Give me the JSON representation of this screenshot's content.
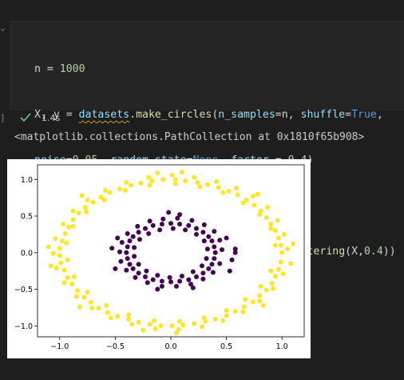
{
  "cell": {
    "code_lines": [
      "n = 1000",
      "X, y = datasets.make_circles(n_samples=n, shuffle=True,",
      "noise=0.05, random_state=None, factor = 0.4)",
      "",
      "plt.scatter(X[:,0],X[:,1],c = spectral_clustering(X,0.4))"
    ],
    "exec_time": "1.4s",
    "output_text": "<matplotlib.collections.PathCollection at 0x1810f65b908>"
  },
  "colors": {
    "outer": "#fde725",
    "inner": "#440154",
    "check": "#73c991"
  },
  "chart_data": {
    "type": "scatter",
    "title": "",
    "xlabel": "",
    "ylabel": "",
    "xlim": [
      -1.2,
      1.2
    ],
    "ylim": [
      -1.15,
      1.2
    ],
    "xticks": [
      -1.0,
      -0.5,
      0.0,
      0.5,
      1.0
    ],
    "xtick_labels": [
      "−1.0",
      "−0.5",
      "0.0",
      "0.5",
      "1.0"
    ],
    "yticks": [
      -1.0,
      -0.5,
      0.0,
      0.5,
      1.0
    ],
    "ytick_labels": [
      "−1.0",
      "−0.5",
      "0.0",
      "0.5",
      "1.0"
    ],
    "grid": false,
    "series": [
      {
        "color": "#fde725",
        "points": [
          [
            1.0,
            0.0
          ],
          [
            0.99,
            0.1
          ],
          [
            0.97,
            0.2
          ],
          [
            0.94,
            0.3
          ],
          [
            0.9,
            0.39
          ],
          [
            0.86,
            0.48
          ],
          [
            0.81,
            0.57
          ],
          [
            0.75,
            0.65
          ],
          [
            0.68,
            0.72
          ],
          [
            0.6,
            0.79
          ],
          [
            0.52,
            0.84
          ],
          [
            0.43,
            0.89
          ],
          [
            0.33,
            0.93
          ],
          [
            0.24,
            0.96
          ],
          [
            0.13,
            0.98
          ],
          [
            0.04,
            1.0
          ],
          [
            -0.07,
            1.0
          ],
          [
            -0.17,
            0.98
          ],
          [
            -0.27,
            0.95
          ],
          [
            -0.36,
            0.92
          ],
          [
            -0.46,
            0.87
          ],
          [
            -0.55,
            0.82
          ],
          [
            -0.63,
            0.76
          ],
          [
            -0.7,
            0.69
          ],
          [
            -0.77,
            0.62
          ],
          [
            -0.83,
            0.54
          ],
          [
            -0.88,
            0.45
          ],
          [
            -0.92,
            0.35
          ],
          [
            -0.95,
            0.26
          ],
          [
            -0.98,
            0.16
          ],
          [
            -1.0,
            0.06
          ],
          [
            -1.0,
            -0.04
          ],
          [
            -0.99,
            -0.14
          ],
          [
            -0.96,
            -0.24
          ],
          [
            -0.93,
            -0.34
          ],
          [
            -0.89,
            -0.43
          ],
          [
            -0.84,
            -0.52
          ],
          [
            -0.78,
            -0.61
          ],
          [
            -0.72,
            -0.68
          ],
          [
            -0.65,
            -0.76
          ],
          [
            -0.57,
            -0.82
          ],
          [
            -0.48,
            -0.87
          ],
          [
            -0.38,
            -0.91
          ],
          [
            -0.29,
            -0.95
          ],
          [
            -0.19,
            -0.98
          ],
          [
            -0.09,
            -1.0
          ],
          [
            0.01,
            -1.0
          ],
          [
            0.11,
            -0.99
          ],
          [
            0.21,
            -0.97
          ],
          [
            0.31,
            -0.94
          ],
          [
            0.4,
            -0.91
          ],
          [
            0.5,
            -0.86
          ],
          [
            0.58,
            -0.8
          ],
          [
            0.66,
            -0.74
          ],
          [
            0.74,
            -0.67
          ],
          [
            0.8,
            -0.59
          ],
          [
            0.86,
            -0.51
          ],
          [
            0.91,
            -0.42
          ],
          [
            0.94,
            -0.32
          ],
          [
            0.97,
            -0.23
          ],
          [
            0.99,
            -0.13
          ],
          [
            1.05,
            0.05
          ],
          [
            1.02,
            0.25
          ],
          [
            0.96,
            0.44
          ],
          [
            0.87,
            0.62
          ],
          [
            0.74,
            0.77
          ],
          [
            0.59,
            0.88
          ],
          [
            0.41,
            0.97
          ],
          [
            0.21,
            1.03
          ],
          [
            0.01,
            1.06
          ],
          [
            -0.2,
            1.03
          ],
          [
            -0.4,
            0.96
          ],
          [
            -0.59,
            0.85
          ],
          [
            -0.75,
            0.72
          ],
          [
            -0.88,
            0.57
          ],
          [
            -0.97,
            0.39
          ],
          [
            -1.04,
            0.19
          ],
          [
            -1.06,
            -0.01
          ],
          [
            -1.03,
            -0.21
          ],
          [
            -0.96,
            -0.41
          ],
          [
            -0.85,
            -0.6
          ],
          [
            -0.71,
            -0.76
          ],
          [
            -0.54,
            -0.89
          ],
          [
            -0.35,
            -0.98
          ],
          [
            -0.14,
            -1.04
          ],
          [
            0.07,
            -1.05
          ],
          [
            0.28,
            -1.01
          ],
          [
            0.47,
            -0.93
          ],
          [
            0.65,
            -0.81
          ],
          [
            0.8,
            -0.66
          ],
          [
            0.92,
            -0.49
          ],
          [
            1.01,
            -0.29
          ],
          [
            0.94,
            0.1
          ],
          [
            0.9,
            0.33
          ],
          [
            0.8,
            0.52
          ],
          [
            0.65,
            0.68
          ],
          [
            0.47,
            0.82
          ],
          [
            0.26,
            0.9
          ],
          [
            0.04,
            0.94
          ],
          [
            -0.19,
            0.92
          ],
          [
            -0.41,
            0.85
          ],
          [
            -0.6,
            0.72
          ],
          [
            -0.76,
            0.56
          ],
          [
            -0.88,
            0.36
          ],
          [
            -0.94,
            0.13
          ],
          [
            -0.93,
            -0.1
          ],
          [
            -0.87,
            -0.33
          ],
          [
            -0.75,
            -0.54
          ],
          [
            -0.58,
            -0.72
          ],
          [
            -0.38,
            -0.85
          ],
          [
            -0.15,
            -0.93
          ],
          [
            0.08,
            -0.94
          ],
          [
            0.3,
            -0.89
          ],
          [
            0.5,
            -0.79
          ],
          [
            0.67,
            -0.64
          ],
          [
            0.81,
            -0.46
          ],
          [
            0.9,
            -0.25
          ],
          [
            1.1,
            0.12
          ],
          [
            1.08,
            -0.15
          ],
          [
            -1.1,
            0.08
          ],
          [
            -1.08,
            -0.18
          ],
          [
            0.1,
            1.1
          ],
          [
            -0.12,
            1.09
          ],
          [
            0.05,
            -1.1
          ],
          [
            -0.25,
            -1.06
          ],
          [
            0.78,
            0.8
          ],
          [
            -0.8,
            0.78
          ],
          [
            -0.82,
            -0.74
          ],
          [
            0.83,
            -0.72
          ]
        ]
      },
      {
        "color": "#440154",
        "points": [
          [
            0.4,
            0.0
          ],
          [
            0.39,
            0.08
          ],
          [
            0.37,
            0.16
          ],
          [
            0.34,
            0.22
          ],
          [
            0.29,
            0.28
          ],
          [
            0.23,
            0.33
          ],
          [
            0.16,
            0.37
          ],
          [
            0.08,
            0.39
          ],
          [
            0.0,
            0.4
          ],
          [
            -0.08,
            0.39
          ],
          [
            -0.16,
            0.37
          ],
          [
            -0.23,
            0.33
          ],
          [
            -0.29,
            0.28
          ],
          [
            -0.34,
            0.22
          ],
          [
            -0.37,
            0.16
          ],
          [
            -0.39,
            0.08
          ],
          [
            -0.4,
            0.0
          ],
          [
            -0.39,
            -0.08
          ],
          [
            -0.37,
            -0.16
          ],
          [
            -0.34,
            -0.22
          ],
          [
            -0.29,
            -0.28
          ],
          [
            -0.23,
            -0.33
          ],
          [
            -0.16,
            -0.37
          ],
          [
            -0.08,
            -0.39
          ],
          [
            0.0,
            -0.4
          ],
          [
            0.08,
            -0.39
          ],
          [
            0.16,
            -0.37
          ],
          [
            0.23,
            -0.33
          ],
          [
            0.29,
            -0.28
          ],
          [
            0.34,
            -0.22
          ],
          [
            0.37,
            -0.16
          ],
          [
            0.39,
            -0.08
          ],
          [
            0.46,
            0.04
          ],
          [
            0.44,
            0.17
          ],
          [
            0.39,
            0.29
          ],
          [
            0.3,
            0.38
          ],
          [
            0.19,
            0.44
          ],
          [
            0.06,
            0.47
          ],
          [
            -0.07,
            0.46
          ],
          [
            -0.19,
            0.43
          ],
          [
            -0.3,
            0.36
          ],
          [
            -0.39,
            0.26
          ],
          [
            -0.44,
            0.14
          ],
          [
            -0.46,
            0.01
          ],
          [
            -0.45,
            -0.12
          ],
          [
            -0.4,
            -0.24
          ],
          [
            -0.32,
            -0.34
          ],
          [
            -0.21,
            -0.41
          ],
          [
            -0.08,
            -0.46
          ],
          [
            0.05,
            -0.46
          ],
          [
            0.18,
            -0.43
          ],
          [
            0.29,
            -0.36
          ],
          [
            0.38,
            -0.27
          ],
          [
            0.44,
            -0.15
          ],
          [
            0.33,
            0.05
          ],
          [
            0.3,
            0.16
          ],
          [
            0.23,
            0.25
          ],
          [
            0.13,
            0.31
          ],
          [
            0.02,
            0.33
          ],
          [
            -0.1,
            0.31
          ],
          [
            -0.2,
            0.26
          ],
          [
            -0.28,
            0.18
          ],
          [
            -0.33,
            0.07
          ],
          [
            -0.33,
            -0.05
          ],
          [
            -0.29,
            -0.16
          ],
          [
            -0.22,
            -0.25
          ],
          [
            -0.12,
            -0.31
          ],
          [
            -0.01,
            -0.34
          ],
          [
            0.1,
            -0.32
          ],
          [
            0.2,
            -0.26
          ],
          [
            0.28,
            -0.18
          ],
          [
            0.32,
            -0.08
          ],
          [
            0.08,
            0.52
          ],
          [
            -0.02,
            0.55
          ],
          [
            0.55,
            -0.1
          ],
          [
            0.58,
            0.05
          ],
          [
            -0.5,
            -0.22
          ],
          [
            -0.48,
            0.2
          ],
          [
            0.2,
            -0.48
          ],
          [
            -0.12,
            -0.5
          ],
          [
            0.5,
            0.2
          ],
          [
            0.53,
            -0.25
          ],
          [
            0.58,
            0.0
          ],
          [
            -0.53,
            0.06
          ]
        ]
      }
    ]
  }
}
